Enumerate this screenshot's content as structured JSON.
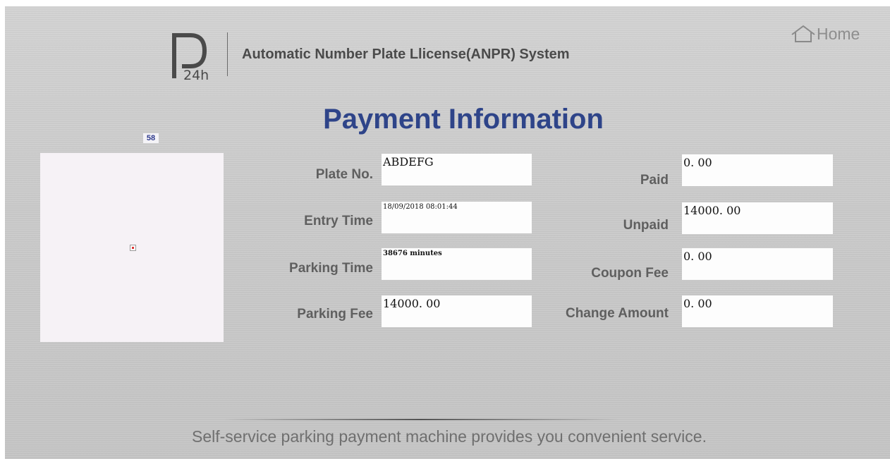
{
  "header": {
    "logo_text": "P 24h",
    "system_title": "Automatic Number Plate Llicense(ANPR) System",
    "home_label": "Home"
  },
  "page_title": "Payment Information",
  "counter": "58",
  "fields": {
    "plate_no": {
      "label": "Plate No.",
      "value": "ABDEFG"
    },
    "entry_time": {
      "label": "Entry Time",
      "value": "18/09/2018 08:01:44"
    },
    "parking_time": {
      "label": "Parking Time",
      "value": "38676 minutes"
    },
    "parking_fee": {
      "label": "Parking Fee",
      "value": "14000. 00"
    },
    "paid": {
      "label": "Paid",
      "value": "0. 00"
    },
    "unpaid": {
      "label": "Unpaid",
      "value": "14000. 00"
    },
    "coupon_fee": {
      "label": "Coupon Fee",
      "value": "0. 00"
    },
    "change_amount": {
      "label": "Change Amount",
      "value": "0. 00"
    }
  },
  "footer": "Self-service parking payment machine provides you convenient service.",
  "colors": {
    "title_blue": "#2e4489",
    "background": "#cccccc",
    "field_bg": "#fdfdfd"
  }
}
